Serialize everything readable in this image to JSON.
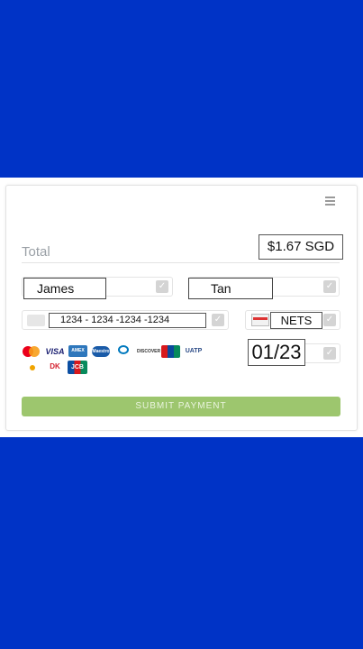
{
  "payment": {
    "total_label": "Total",
    "amount": "$1.67 SGD",
    "first_name": "James",
    "last_name": "Tan",
    "card_number": "1234 - 1234 -1234 -1234",
    "payment_method": "NETS",
    "expiry": "01/23",
    "submit_label": "SUBMIT PAYMENT"
  },
  "card_logos": {
    "mastercard": "mastercard-logo",
    "visa": "VISA",
    "amex": "AMEX",
    "maestro": "Maestro",
    "diners": "Diners Club",
    "discover": "DISCOVER",
    "unionpay": "UnionPay",
    "uatp": "UATP",
    "carteblanche": "Carte Blanche",
    "dankort": "DK",
    "jcb": "JCB"
  },
  "colors": {
    "background_band": "#0033c6",
    "submit_button": "#9dc66e",
    "check": "#d4d4d4"
  }
}
